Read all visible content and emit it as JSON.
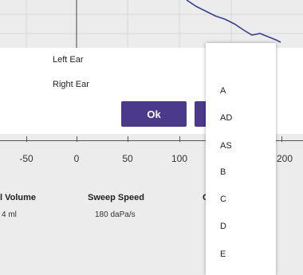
{
  "dialog": {
    "options": [
      "Left Ear",
      "Right Ear"
    ],
    "ok_label": "Ok"
  },
  "dropdown": {
    "items": [
      "A",
      "AD",
      "AS",
      "B",
      "C",
      "D",
      "E"
    ]
  },
  "chart": {
    "x_ticks": [
      "-50",
      "0",
      "50",
      "100",
      "200"
    ],
    "line_color": "#3c3f8f"
  },
  "info": {
    "volume_label": "l Volume",
    "volume_value": "4 ml",
    "sweep_label": "Sweep Speed",
    "sweep_value": "180 daPa/s",
    "partial_label": "C"
  },
  "colors": {
    "accent": "#4b3a8c",
    "panel_bg": "#ececec"
  }
}
